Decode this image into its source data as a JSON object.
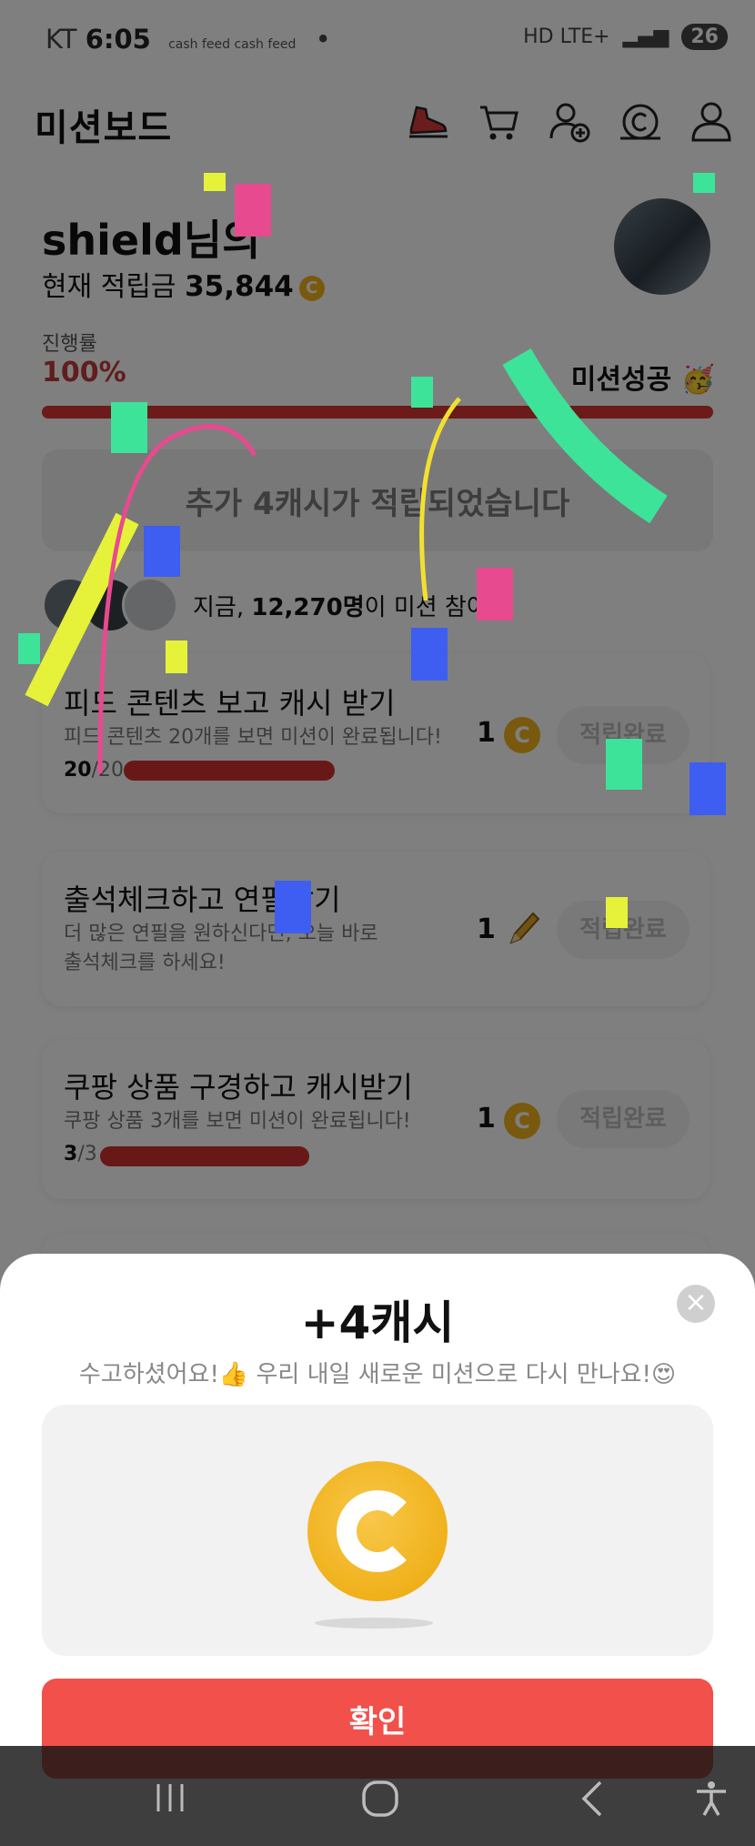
{
  "status": {
    "carrier": "KT",
    "time": "6:05",
    "app_icons": "cash feed cash feed",
    "network": "HD LTE+",
    "battery": "26"
  },
  "header": {
    "title": "미션보드",
    "icons": [
      "shoe-icon",
      "cart-icon",
      "add-user-icon",
      "cash-icon",
      "profile-icon"
    ]
  },
  "user": {
    "greeting": "shield님의",
    "balance_label": "현재 적립금",
    "balance_value": "35,844",
    "coin_symbol": "C"
  },
  "progress": {
    "label": "진행률",
    "value": "100%",
    "value_fraction": 1.0,
    "status": "미션성공 🥳"
  },
  "reward_banner": "추가 4캐시가 적립되었습니다",
  "participants": {
    "prefix": "지금, ",
    "count": "12,270명",
    "suffix": "이 미션 참여중"
  },
  "missions": [
    {
      "title": "피드 콘텐츠 보고 캐시 받기",
      "desc": "피드 콘텐츠 20개를 보면 미션이 완료됩니다!",
      "progress_done": "20",
      "progress_total": "/20",
      "progress_fraction": 1.0,
      "reward": "1",
      "reward_icon": "coin-icon",
      "button": "적립완료"
    },
    {
      "title": "출석체크하고 연필받기",
      "desc_line1": "더 많은 연필을 원하신다면, 오늘 바로",
      "desc_line2": "출석체크를 하세요!",
      "reward": "1",
      "reward_icon": "pencil-icon",
      "button": "적립완료"
    },
    {
      "title": "쿠팡 상품 구경하고 캐시받기",
      "desc": "쿠팡 상품 3개를 보면 미션이 완료됩니다!",
      "progress_done": "3",
      "progress_total": "/3",
      "progress_fraction": 1.0,
      "reward": "1",
      "reward_icon": "coin-icon",
      "button": "적립완료"
    }
  ],
  "sheet": {
    "title": "+4캐시",
    "subtitle": "수고하셨어요!👍 우리 내일 새로운 미션으로 다시 만나요!😍",
    "close": "×",
    "confirm": "확인"
  },
  "navbar": {
    "icons": [
      "recent-apps-icon",
      "home-icon",
      "back-icon",
      "accessibility-icon"
    ]
  },
  "colors": {
    "accent_red": "#f2504b",
    "progress_red": "#d83535",
    "coin_gold": "#f0b31a",
    "confetti": [
      "#3ee39a",
      "#e84a8f",
      "#e6f23a",
      "#3d5ef0",
      "#f2e030"
    ]
  }
}
